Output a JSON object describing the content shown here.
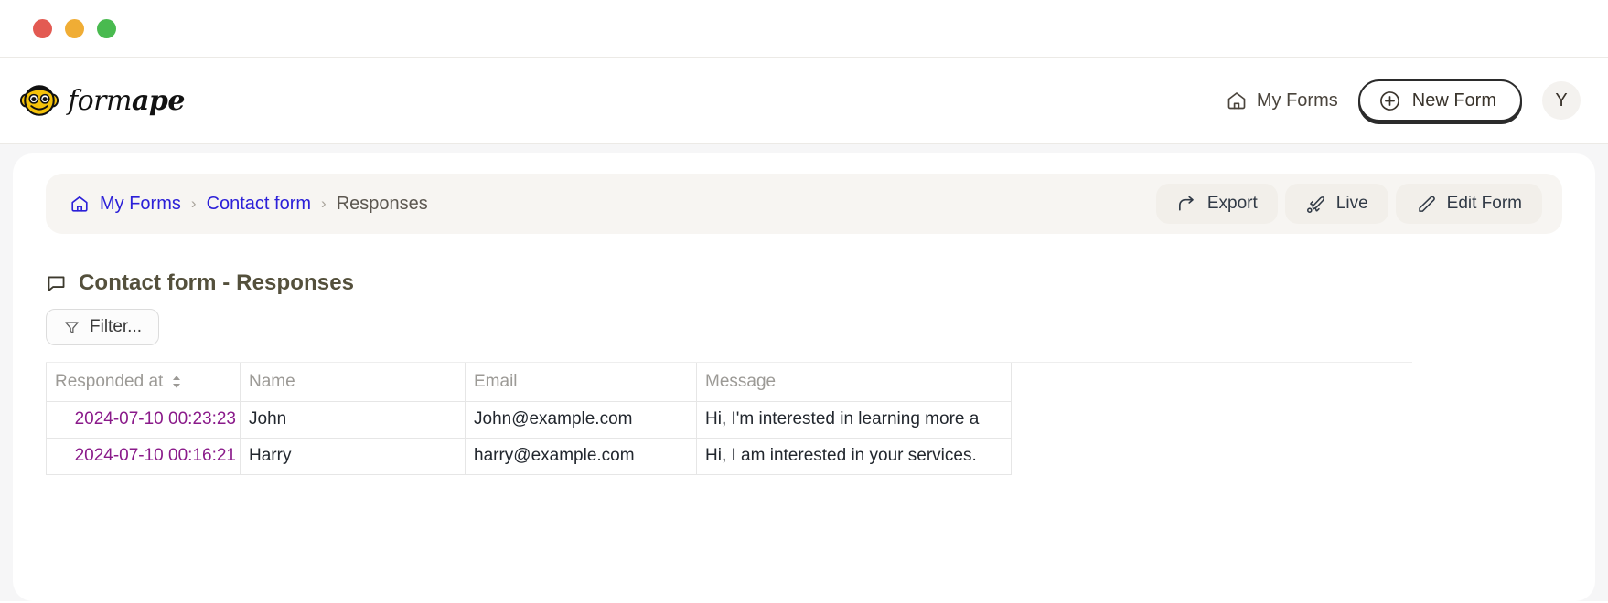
{
  "window": {
    "controls": [
      {
        "name": "close",
        "color": "#e35a52"
      },
      {
        "name": "minimize",
        "color": "#f0ad35"
      },
      {
        "name": "maximize",
        "color": "#49ba4f"
      }
    ]
  },
  "header": {
    "brand": {
      "icon": "monkey-face-logo",
      "word_light": "form",
      "word_bold": "ape"
    },
    "my_forms_label": "My Forms",
    "my_forms_icon": "home-icon",
    "new_form_label": "New Form",
    "new_form_icon": "plus-circle-icon",
    "avatar_initial": "Y"
  },
  "breadcrumb": {
    "home_icon": "home-icon",
    "items": [
      {
        "label": "My Forms",
        "type": "link"
      },
      {
        "label": "Contact form",
        "type": "link"
      },
      {
        "label": "Responses",
        "type": "current"
      }
    ],
    "separator": "›",
    "actions": [
      {
        "label": "Export",
        "icon": "share-arrow-icon"
      },
      {
        "label": "Live",
        "icon": "rocket-icon"
      },
      {
        "label": "Edit Form",
        "icon": "pencil-icon"
      }
    ]
  },
  "main": {
    "title": "Contact form - Responses",
    "title_icon": "speech-bubble-icon",
    "filter_label": "Filter...",
    "filter_icon": "funnel-icon",
    "table": {
      "columns": [
        {
          "label": "Responded at",
          "sortable": true,
          "sort_icon": "sort-updown-icon"
        },
        {
          "label": "Name",
          "sortable": false
        },
        {
          "label": "Email",
          "sortable": false
        },
        {
          "label": "Message",
          "sortable": false
        }
      ],
      "rows": [
        {
          "responded_at": "2024-07-10 00:23:23",
          "name": "John",
          "email": "John@example.com",
          "message": "Hi, I'm interested in learning more a"
        },
        {
          "responded_at": "2024-07-10 00:16:21",
          "name": "Harry",
          "email": "harry@example.com",
          "message": "Hi, I am interested in your services."
        }
      ]
    }
  },
  "colors": {
    "link": "#2c20d8",
    "date_text": "#8a1a8a",
    "title_text": "#54503c",
    "brand_yellow": "#f5c20a",
    "page_bg": "#f6f6f7",
    "crumbbar_bg": "#f7f5f2"
  }
}
